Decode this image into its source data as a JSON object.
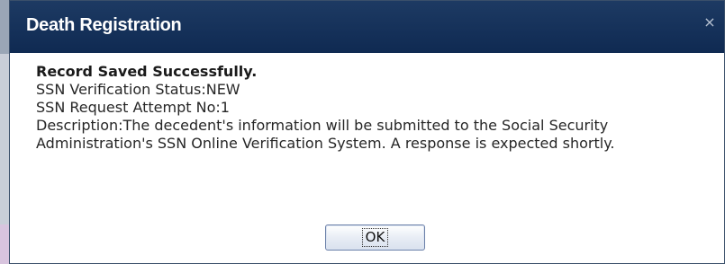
{
  "dialog": {
    "title": "Death Registration",
    "close_glyph": "×",
    "close_icon": "close-icon"
  },
  "message": {
    "heading": "Record Saved Successfully.",
    "status_line": "SSN Verification Status:NEW",
    "attempt_line": "SSN Request Attempt No:1",
    "description_line": "Description:The decedent's information will be submitted to the Social Security Administration's SSN Online Verification System. A response is expected shortly."
  },
  "buttons": {
    "ok_label": "OK"
  },
  "colors": {
    "titlebar": "#0f2a52",
    "title_text": "#ffffff",
    "body_text": "#262626"
  }
}
